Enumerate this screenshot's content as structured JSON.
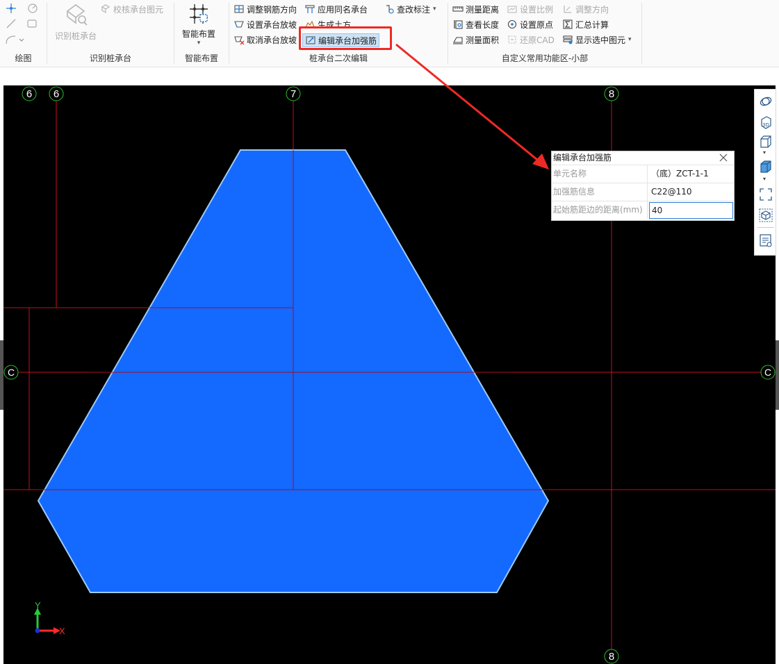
{
  "ribbon": {
    "draw": {
      "label": "绘图"
    },
    "recognize": {
      "identify_pile_cap": "识别桩承台",
      "check_pile_cap_element": "校核承台图元",
      "label": "识别桩承台"
    },
    "smart": {
      "smart_layout": "智能布置",
      "label": "智能布置"
    },
    "edit": {
      "adjust_rebar_direction": "调整钢筋方向",
      "set_cap_slope": "设置承台放坡",
      "cancel_cap_slope": "取消承台放坡",
      "apply_same_name_cap": "应用同名承台",
      "generate_earthwork": "生成土方",
      "edit_cap_reinforcement": "编辑承台加强筋",
      "check_annotation": "查改标注",
      "label": "桩承台二次编辑"
    },
    "custom": {
      "measure_distance": "测量距离",
      "view_length": "查看长度",
      "measure_area": "测量面积",
      "set_scale": "设置比例",
      "set_origin": "设置原点",
      "restore_cad": "还原CAD",
      "adjust_direction": "调整方向",
      "summary_calc": "汇总计算",
      "show_selected": "显示选中图元",
      "label": "自定义常用功能区-小部"
    }
  },
  "canvas": {
    "axes": {
      "top": [
        "6",
        "6",
        "7",
        "8"
      ],
      "bottom": [
        "8"
      ],
      "left": "C",
      "right": "C",
      "coord_y": "Y",
      "coord_x": "X"
    },
    "colors": {
      "background": "#000000",
      "element_fill": "#1469ff",
      "element_stroke": "#9fcaf6",
      "grid_line": "#c3101c",
      "axis_circle": "#2fbf2f",
      "highlight": "#ee2a24"
    }
  },
  "viewbar": {
    "icons": [
      "dynamic-observe-icon",
      "3d-view-icon",
      "top-view-icon",
      "cube-view-icon",
      "fullscreen-icon",
      "element-cube-icon",
      "list-view-icon"
    ]
  },
  "panel": {
    "title": "编辑承台加强筋",
    "rows": [
      {
        "key": "单元名称",
        "value": "（底）ZCT-1-1"
      },
      {
        "key": "加强筋信息",
        "value": "C22@110"
      },
      {
        "key": "起始筋距边的距离(mm)",
        "value": "40"
      }
    ]
  }
}
